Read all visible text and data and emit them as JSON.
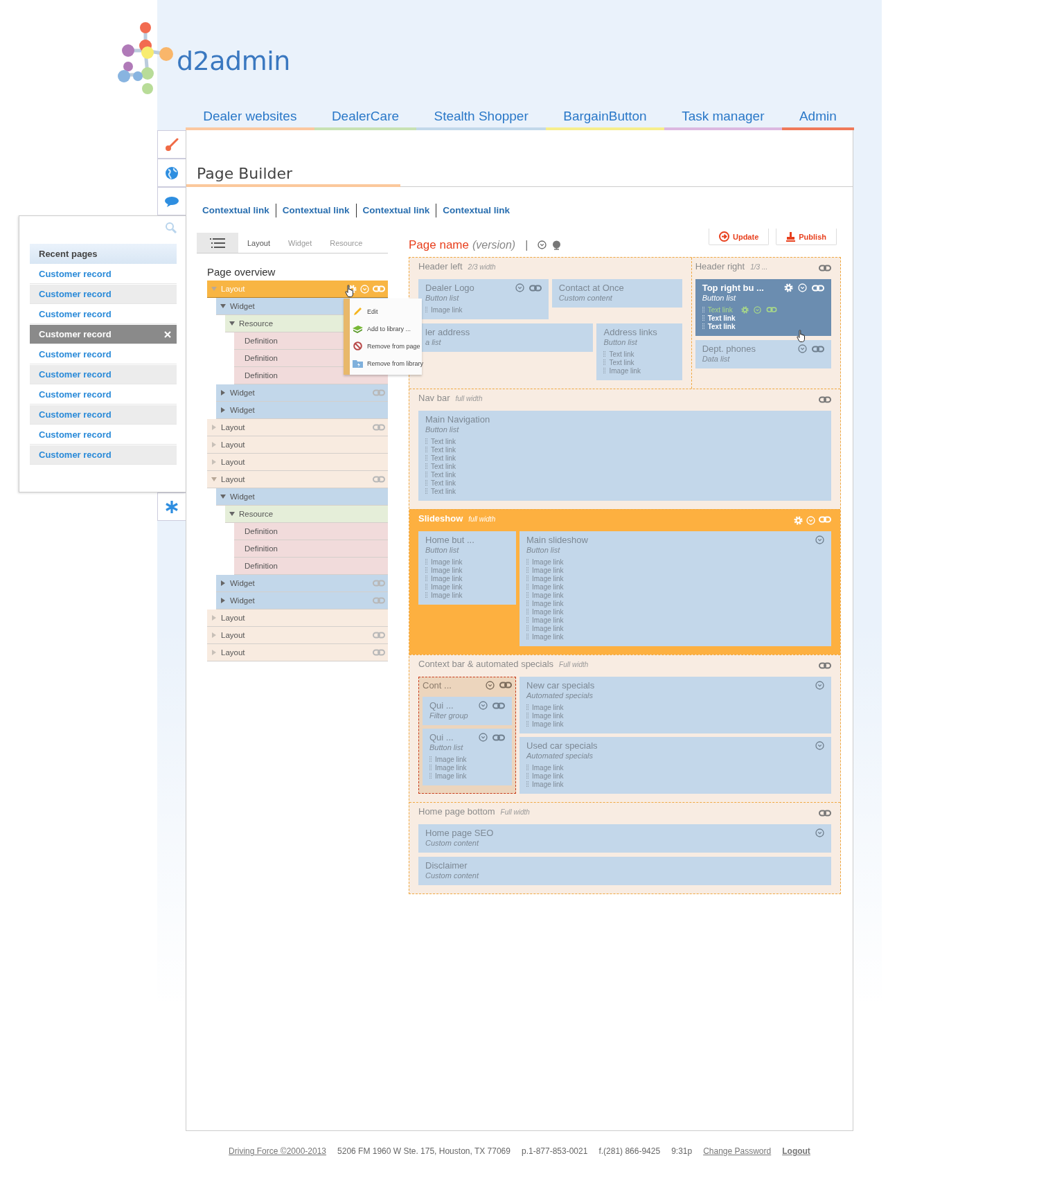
{
  "logo": {
    "text": "d2admin"
  },
  "nav": {
    "tabs": [
      {
        "label": "Dealer websites",
        "color": "#fbc8a0"
      },
      {
        "label": "DealerCare",
        "color": "#c8e2b4"
      },
      {
        "label": "Stealth Shopper",
        "color": "#c2d8ea"
      },
      {
        "label": "BargainButton",
        "color": "#f6ee8c"
      },
      {
        "label": "Task manager",
        "color": "#dcb8e0"
      },
      {
        "label": "Admin",
        "color": "#f07a5a"
      }
    ]
  },
  "recent": {
    "title": "Recent pages",
    "items": [
      {
        "label": "Customer record",
        "selected": false
      },
      {
        "label": "Customer record",
        "selected": false
      },
      {
        "label": "Customer record",
        "selected": false
      },
      {
        "label": "Customer record",
        "selected": true
      },
      {
        "label": "Customer record",
        "selected": false
      },
      {
        "label": "Customer record",
        "selected": false
      },
      {
        "label": "Customer record",
        "selected": false
      },
      {
        "label": "Customer record",
        "selected": false
      },
      {
        "label": "Customer record",
        "selected": false
      },
      {
        "label": "Customer record",
        "selected": false
      }
    ]
  },
  "page": {
    "title": "Page Builder",
    "links": [
      "Contextual link",
      "Contextual link",
      "Contextual link",
      "Contextual link"
    ]
  },
  "overview": {
    "tabs": [
      {
        "label": "Layout",
        "selected": true
      },
      {
        "label": "Widget",
        "selected": false
      },
      {
        "label": "Resource",
        "selected": false
      }
    ],
    "title": "Page overview",
    "tree": [
      {
        "kind": "layout",
        "label": "Layout",
        "expanded": true,
        "selected": true,
        "link": true,
        "children": [
          {
            "kind": "widget",
            "label": "Widget",
            "expanded": true,
            "selected": false,
            "children": [
              {
                "kind": "resource",
                "label": "Resource",
                "expanded": true,
                "selected": false,
                "children": [
                  {
                    "kind": "definition",
                    "label": "Definition",
                    "selected": false
                  },
                  {
                    "kind": "definition",
                    "label": "Definition",
                    "selected": false
                  },
                  {
                    "kind": "definition",
                    "label": "Definition",
                    "selected": false
                  }
                ]
              }
            ]
          },
          {
            "kind": "widget",
            "label": "Widget",
            "expanded": false,
            "selected": false,
            "link": true
          },
          {
            "kind": "widget",
            "label": "Widget",
            "expanded": false,
            "selected": false
          }
        ]
      },
      {
        "kind": "layout",
        "label": "Layout",
        "expanded": false,
        "selected": false,
        "link": true
      },
      {
        "kind": "layout",
        "label": "Layout",
        "expanded": false,
        "selected": false
      },
      {
        "kind": "layout",
        "label": "Layout",
        "expanded": false,
        "selected": false
      },
      {
        "kind": "layout",
        "label": "Layout",
        "expanded": true,
        "selected": false,
        "link": true,
        "children": [
          {
            "kind": "widget",
            "label": "Widget",
            "expanded": true,
            "selected": false,
            "children": [
              {
                "kind": "resource",
                "label": "Resource",
                "expanded": true,
                "selected": false,
                "children": [
                  {
                    "kind": "definition",
                    "label": "Definition",
                    "selected": false
                  },
                  {
                    "kind": "definition",
                    "label": "Definition",
                    "selected": false
                  },
                  {
                    "kind": "definition",
                    "label": "Definition",
                    "selected": false
                  }
                ]
              }
            ]
          },
          {
            "kind": "widget",
            "label": "Widget",
            "expanded": false,
            "selected": false,
            "link": true
          },
          {
            "kind": "widget",
            "label": "Widget",
            "expanded": false,
            "selected": false,
            "link": true
          }
        ]
      },
      {
        "kind": "layout",
        "label": "Layout",
        "expanded": false,
        "selected": false
      },
      {
        "kind": "layout",
        "label": "Layout",
        "expanded": false,
        "selected": false,
        "link": true
      },
      {
        "kind": "layout",
        "label": "Layout",
        "expanded": false,
        "selected": false,
        "link": true
      }
    ],
    "menu": [
      {
        "kind": "edit",
        "label": "Edit"
      },
      {
        "kind": "add",
        "label": "Add to library ..."
      },
      {
        "kind": "remove",
        "label": "Remove from page"
      },
      {
        "kind": "unlibrary",
        "label": "Remove from library"
      }
    ]
  },
  "canvas": {
    "page_name": "Page name",
    "version": "(version)",
    "separator": "|",
    "buttons": [
      {
        "kind": "update",
        "label": "Update"
      },
      {
        "kind": "publish",
        "label": "Publish"
      }
    ],
    "rows": [
      {
        "sections": [
          {
            "title": "Header left",
            "subtitle": "2/3 width",
            "selected": false,
            "rows": [
              [
                {
                  "kind": "widget",
                  "title": "Dealer Logo",
                  "type": "Button list",
                  "selected": false,
                  "history": true,
                  "link": true,
                  "items": [
                    {
                      "label": "Image link"
                    }
                  ]
                },
                {
                  "kind": "widget",
                  "title": "Contact at Once",
                  "type": "Custom content",
                  "selected": false
                }
              ],
              [
                {
                  "kind": "widget",
                  "title": "ler address",
                  "type": "a list",
                  "selected": false
                },
                {
                  "kind": "widget",
                  "title": "Address links",
                  "type": "Button list",
                  "selected": false,
                  "items": [
                    {
                      "label": "Text link"
                    },
                    {
                      "label": "Text link"
                    },
                    {
                      "label": "Image link"
                    }
                  ]
                }
              ]
            ]
          },
          {
            "title": "Header right",
            "subtitle": "1/3 ...",
            "selected": false,
            "link": true,
            "rows": [
              [
                {
                  "kind": "widget",
                  "title": "Top right bu ...",
                  "type": "Button list",
                  "selected": true,
                  "settings": true,
                  "history": true,
                  "link": true,
                  "items": [
                    {
                      "label": "Text link",
                      "active": true
                    },
                    {
                      "label": "Text link"
                    },
                    {
                      "label": "Text link"
                    }
                  ]
                }
              ],
              [
                {
                  "kind": "widget",
                  "title": "Dept. phones",
                  "type": "Data list",
                  "selected": false,
                  "history": true,
                  "link": true
                }
              ]
            ]
          }
        ]
      },
      {
        "sections": [
          {
            "title": "Nav bar",
            "subtitle": "full width",
            "selected": false,
            "link": true,
            "rows": [
              [
                {
                  "kind": "widget",
                  "title": "Main Navigation",
                  "type": "Button list",
                  "selected": false,
                  "items": [
                    {
                      "label": "Text link"
                    },
                    {
                      "label": "Text link"
                    },
                    {
                      "label": "Text link"
                    },
                    {
                      "label": "Text link"
                    },
                    {
                      "label": "Text link"
                    },
                    {
                      "label": "Text link"
                    },
                    {
                      "label": "Text link"
                    }
                  ]
                }
              ]
            ]
          }
        ]
      },
      {
        "sections": [
          {
            "title": "Slideshow",
            "subtitle": "full width",
            "selected": true,
            "settings": true,
            "history": true,
            "link": true,
            "rows": [
              [
                {
                  "kind": "widget",
                  "title": "Home but ...",
                  "type": "Button list",
                  "selected": false,
                  "items": [
                    {
                      "label": "Image link"
                    },
                    {
                      "label": "Image link"
                    },
                    {
                      "label": "Image link"
                    },
                    {
                      "label": "Image link"
                    },
                    {
                      "label": "Image link"
                    }
                  ]
                },
                {
                  "kind": "widget",
                  "title": "Main slideshow",
                  "type": "Button list",
                  "selected": false,
                  "history": true,
                  "items": [
                    {
                      "label": "Image link"
                    },
                    {
                      "label": "Image link"
                    },
                    {
                      "label": "Image link"
                    },
                    {
                      "label": "Image link"
                    },
                    {
                      "label": "Image link"
                    },
                    {
                      "label": "Image link"
                    },
                    {
                      "label": "Image link"
                    },
                    {
                      "label": "Image link"
                    },
                    {
                      "label": "Image link"
                    },
                    {
                      "label": "Image link"
                    }
                  ]
                }
              ]
            ]
          }
        ]
      },
      {
        "sections": [
          {
            "title": "Context bar & automated specials",
            "subtitle": "Full width",
            "selected": false,
            "link": true,
            "rows": [
              [
                {
                  "kind": "section",
                  "title": "Cont ...",
                  "history": true,
                  "link": true,
                  "widgets": [
                    {
                      "kind": "widget",
                      "title": "Qui ...",
                      "type": "Filter group",
                      "selected": false,
                      "history": true,
                      "link": true
                    },
                    {
                      "kind": "widget",
                      "title": "Qui ...",
                      "type": "Button list",
                      "selected": false,
                      "history": true,
                      "link": true,
                      "items": [
                        {
                          "label": "Image link"
                        },
                        {
                          "label": "Image link"
                        },
                        {
                          "label": "Image link"
                        }
                      ]
                    }
                  ]
                },
                {
                  "kind": "stack",
                  "widgets": [
                    {
                      "kind": "widget",
                      "title": "New car specials",
                      "type": "Automated specials",
                      "selected": false,
                      "history": true,
                      "items": [
                        {
                          "label": "Image link"
                        },
                        {
                          "label": "Image link"
                        },
                        {
                          "label": "Image link"
                        }
                      ]
                    },
                    {
                      "kind": "widget",
                      "title": "Used car specials",
                      "type": "Automated specials",
                      "selected": false,
                      "history": true,
                      "items": [
                        {
                          "label": "Image link"
                        },
                        {
                          "label": "Image link"
                        },
                        {
                          "label": "Image link"
                        }
                      ]
                    }
                  ]
                }
              ]
            ]
          }
        ]
      },
      {
        "sections": [
          {
            "title": "Home page bottom",
            "subtitle": "Full width",
            "selected": false,
            "link": true,
            "rows": [
              [
                {
                  "kind": "widget",
                  "title": "Home page SEO",
                  "type": "Custom content",
                  "selected": false,
                  "history": true
                }
              ],
              [
                {
                  "kind": "widget",
                  "title": "Disclaimer",
                  "type": "Custom content",
                  "selected": false
                }
              ]
            ]
          }
        ]
      }
    ]
  },
  "footer": {
    "items": [
      {
        "kind": "link",
        "label": "Driving Force ©2000-2013"
      },
      {
        "kind": "text",
        "label": "5206 FM 1960 W Ste. 175, Houston, TX 77069"
      },
      {
        "kind": "text",
        "label": "p.1-877-853-0021"
      },
      {
        "kind": "text",
        "label": "f.(281) 866-9425"
      },
      {
        "kind": "text",
        "label": "9:31p"
      },
      {
        "kind": "link",
        "label": "Change Password"
      },
      {
        "kind": "bold",
        "label": "Logout"
      }
    ]
  }
}
